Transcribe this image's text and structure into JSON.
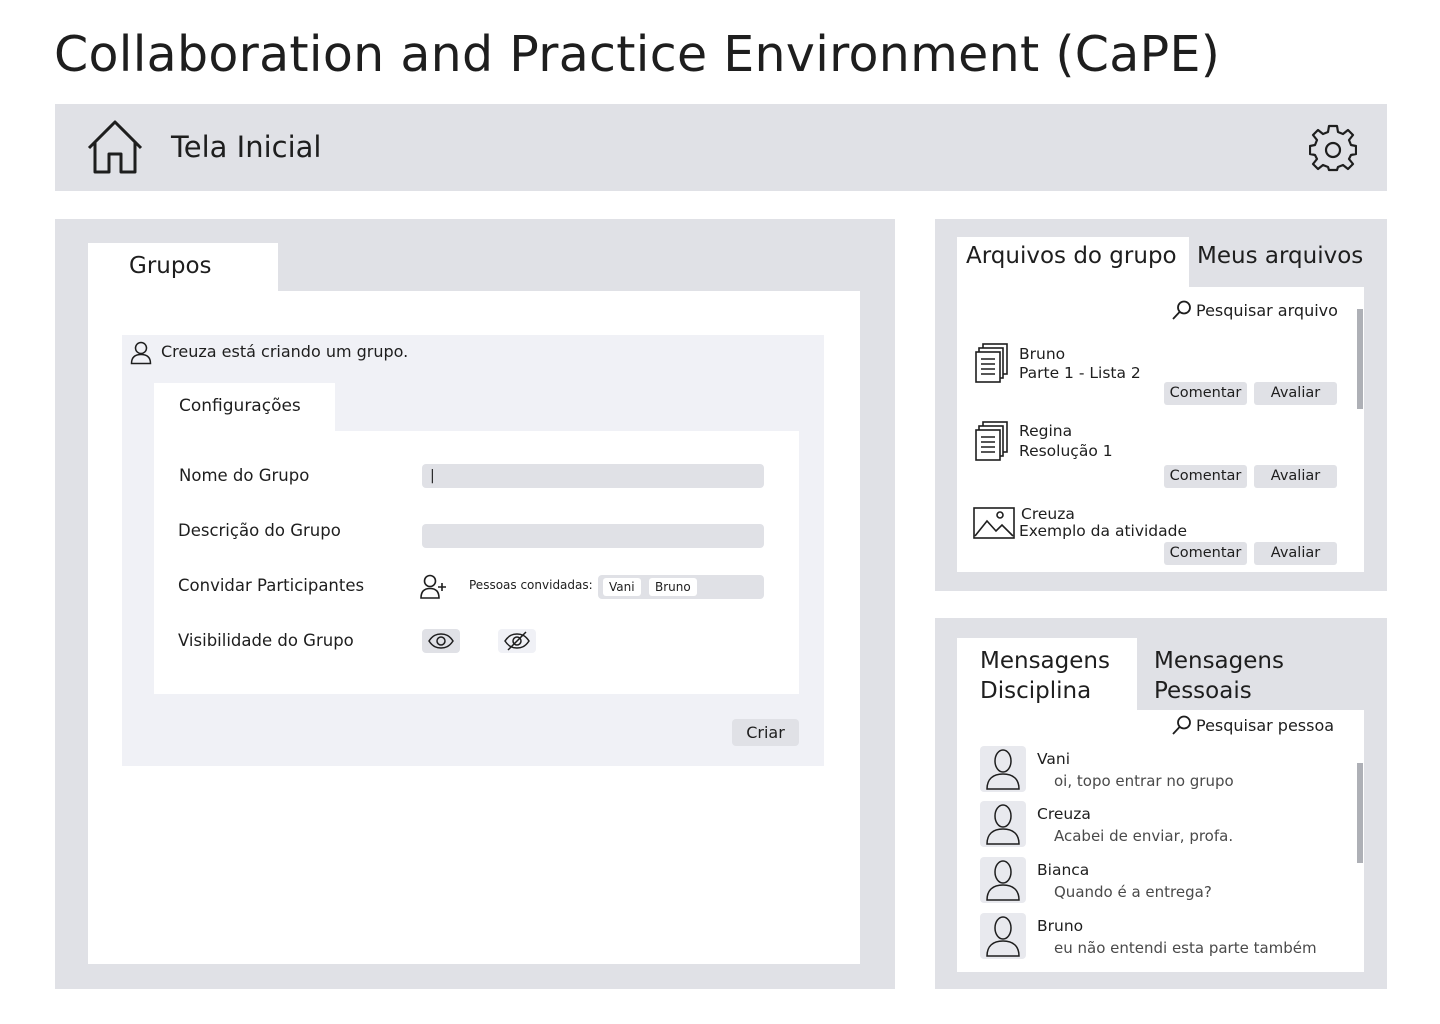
{
  "app": {
    "title": "Collaboration and Practice Environment (CaPE)"
  },
  "topbar": {
    "home_label": "Tela Inicial"
  },
  "groups": {
    "tab_label": "Grupos",
    "creator_notice": "Creuza está criando um grupo.",
    "config_tab_label": "Configurações",
    "fields": {
      "name_label": "Nome do Grupo",
      "name_value": "|",
      "description_label": "Descrição do Grupo",
      "description_value": "",
      "invite_label": "Convidar Participantes",
      "invited_label": "Pessoas convidadas:",
      "invited": [
        "Vani",
        "Bruno"
      ],
      "visibility_label": "Visibilidade do Grupo"
    },
    "create_button": "Criar"
  },
  "files": {
    "tab_active": "Arquivos do grupo",
    "tab_other": "Meus arquivos",
    "search_label": "Pesquisar arquivo",
    "items": [
      {
        "author": "Bruno",
        "title": "Parte 1 - Lista 2",
        "icon": "document-icon",
        "comment": "Comentar",
        "rate": "Avaliar"
      },
      {
        "author": "Regina",
        "title": "Resolução 1",
        "icon": "document-icon",
        "comment": "Comentar",
        "rate": "Avaliar"
      },
      {
        "author": "Creuza",
        "title": "Exemplo da atividade",
        "icon": "image-icon",
        "comment": "Comentar",
        "rate": "Avaliar"
      }
    ]
  },
  "messages": {
    "tab_active_line1": "Mensagens",
    "tab_active_line2": "Disciplina",
    "tab_other_line1": "Mensagens",
    "tab_other_line2": "Pessoais",
    "search_label": "Pesquisar pessoa",
    "items": [
      {
        "name": "Vani",
        "text": "oi, topo entrar no grupo"
      },
      {
        "name": "Creuza",
        "text": "Acabei de enviar, profa."
      },
      {
        "name": "Bianca",
        "text": "Quando é a entrega?"
      },
      {
        "name": "Bruno",
        "text": "eu não entendi esta parte também"
      }
    ]
  }
}
